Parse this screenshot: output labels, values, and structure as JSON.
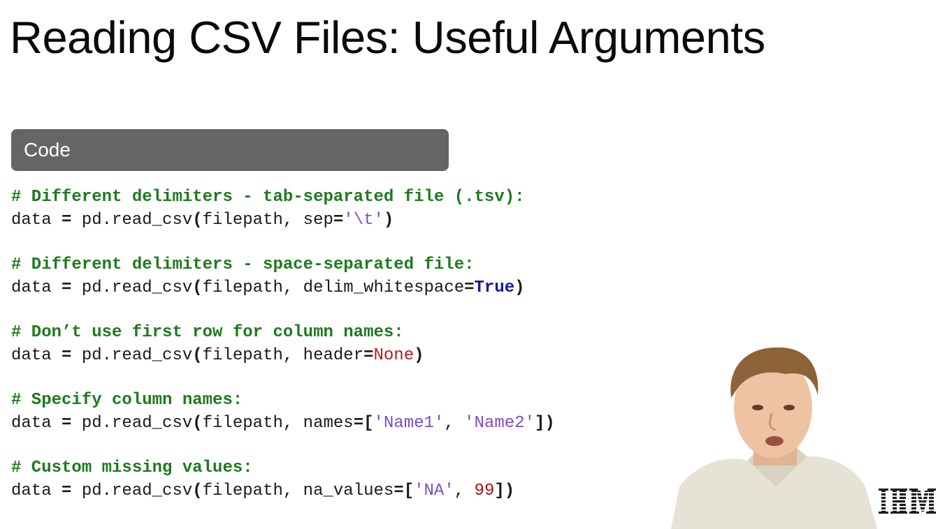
{
  "slide": {
    "title": "Reading CSV Files: Useful Arguments",
    "code_header": "Code"
  },
  "code": [
    {
      "comment": "# Different delimiters - tab-separated file (.tsv):",
      "tokens": [
        {
          "t": "data ",
          "c": "plain"
        },
        {
          "t": "=",
          "c": "op"
        },
        {
          "t": " pd.read_csv",
          "c": "plain"
        },
        {
          "t": "(",
          "c": "op"
        },
        {
          "t": "filepath, sep",
          "c": "plain"
        },
        {
          "t": "=",
          "c": "op"
        },
        {
          "t": "'\\t'",
          "c": "str"
        },
        {
          "t": ")",
          "c": "op"
        }
      ]
    },
    {
      "comment": "# Different delimiters - space-separated file:",
      "tokens": [
        {
          "t": "data ",
          "c": "plain"
        },
        {
          "t": "=",
          "c": "op"
        },
        {
          "t": " pd.read_csv",
          "c": "plain"
        },
        {
          "t": "(",
          "c": "op"
        },
        {
          "t": "filepath, delim_whitespace",
          "c": "plain"
        },
        {
          "t": "=",
          "c": "op"
        },
        {
          "t": "True",
          "c": "kw-true"
        },
        {
          "t": ")",
          "c": "op"
        }
      ]
    },
    {
      "comment": "# Don’t use first row for column names:",
      "tokens": [
        {
          "t": "data ",
          "c": "plain"
        },
        {
          "t": "=",
          "c": "op"
        },
        {
          "t": " pd.read_csv",
          "c": "plain"
        },
        {
          "t": "(",
          "c": "op"
        },
        {
          "t": "filepath, header",
          "c": "plain"
        },
        {
          "t": "=",
          "c": "op"
        },
        {
          "t": "None",
          "c": "kw-none"
        },
        {
          "t": ")",
          "c": "op"
        }
      ]
    },
    {
      "comment": "# Specify column names:",
      "tokens": [
        {
          "t": "data ",
          "c": "plain"
        },
        {
          "t": "=",
          "c": "op"
        },
        {
          "t": " pd.read_csv",
          "c": "plain"
        },
        {
          "t": "(",
          "c": "op"
        },
        {
          "t": "filepath, names",
          "c": "plain"
        },
        {
          "t": "=[",
          "c": "op"
        },
        {
          "t": "'Name1'",
          "c": "str"
        },
        {
          "t": ", ",
          "c": "plain"
        },
        {
          "t": "'Name2'",
          "c": "str"
        },
        {
          "t": "])",
          "c": "op"
        }
      ]
    },
    {
      "comment": "# Custom missing values:",
      "tokens": [
        {
          "t": "data ",
          "c": "plain"
        },
        {
          "t": "=",
          "c": "op"
        },
        {
          "t": " pd.read_csv",
          "c": "plain"
        },
        {
          "t": "(",
          "c": "op"
        },
        {
          "t": "filepath, na_values",
          "c": "plain"
        },
        {
          "t": "=[",
          "c": "op"
        },
        {
          "t": "'NA'",
          "c": "str"
        },
        {
          "t": ", ",
          "c": "plain"
        },
        {
          "t": "99",
          "c": "num"
        },
        {
          "t": "])",
          "c": "op"
        }
      ]
    }
  ],
  "logo": {
    "text": "IBM",
    "icon": "ibm-logo"
  },
  "presenter": {
    "icon": "presenter-video"
  },
  "colors": {
    "comment": "#1d7b1d",
    "string": "#7d4ec4",
    "true_kw": "#1a1a9e",
    "none_kw": "#c21818",
    "number": "#a51616",
    "header_bg": "#656565"
  }
}
